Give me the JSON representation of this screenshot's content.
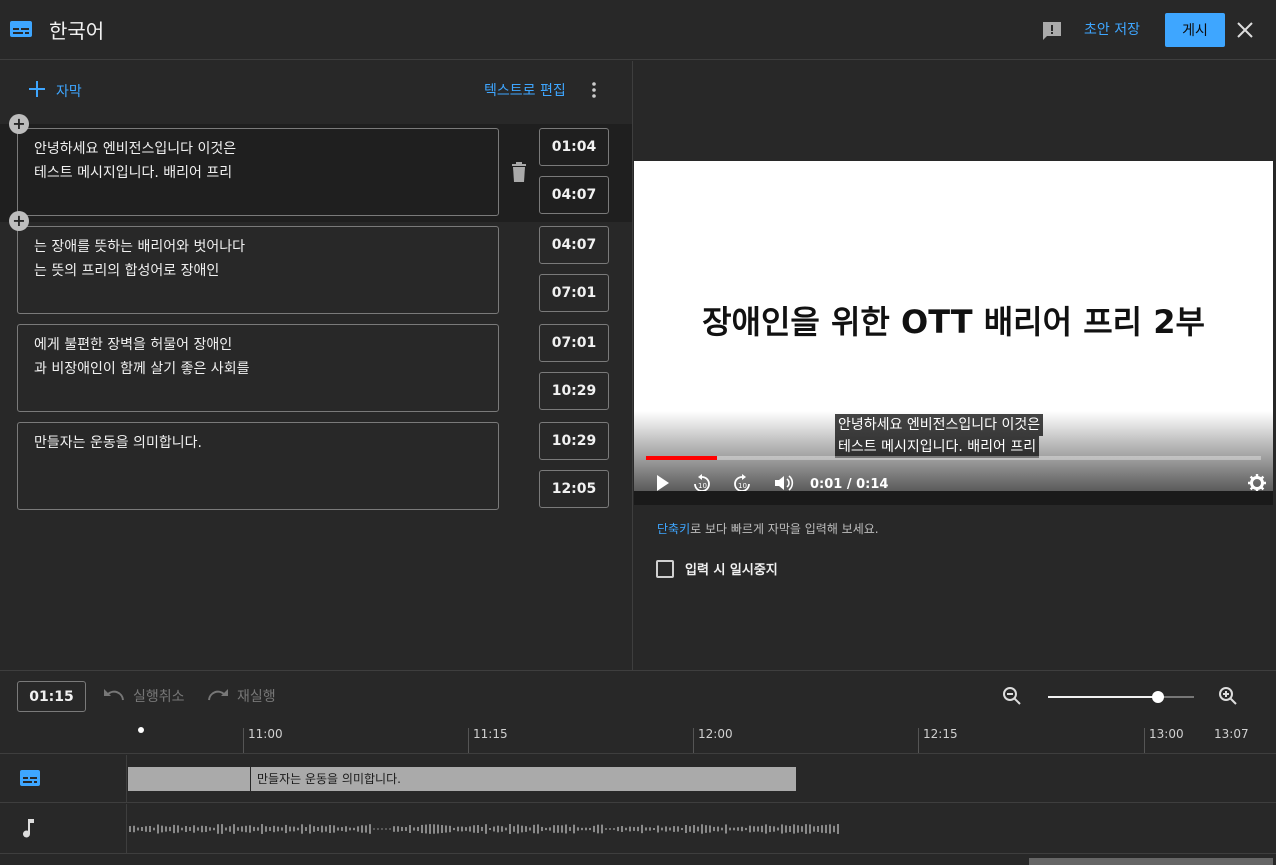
{
  "header": {
    "language": "한국어",
    "save_draft": "초안 저장",
    "publish": "게시"
  },
  "editor": {
    "add_subtitle": "자막",
    "edit_as_text": "텍스트로 편집",
    "cues": [
      {
        "text": "안녕하세요 엔비전스입니다 이것은\n테스트 메시지입니다. 배리어 프리",
        "start": "01:04",
        "end": "04:07"
      },
      {
        "text": "는 장애를 뜻하는 배리어와 벗어나다\n는 뜻의 프리의 합성어로 장애인",
        "start": "04:07",
        "end": "07:01"
      },
      {
        "text": "에게 불편한  장벽을 허물어 장애인\n과 비장애인이 함께 살기 좋은 사회를",
        "start": "07:01",
        "end": "10:29"
      },
      {
        "text": "만들자는 운동을 의미합니다.",
        "start": "10:29",
        "end": "12:05"
      }
    ]
  },
  "video": {
    "slide_title": "장애인을 위한 OTT 배리어 프리 2부",
    "caption_line1": "안녕하세요 엔비전스입니다 이것은",
    "caption_line2": "테스트 메시지입니다. 배리어 프리",
    "time": "0:01 / 0:14",
    "progress": 0.116
  },
  "hint": {
    "link": "단축키",
    "text": "로 보다 빠르게 자막을 입력해 보세요."
  },
  "pause_while_typing": "입력 시 일시중지",
  "toolbar": {
    "current_time": "01:15",
    "undo": "실행취소",
    "redo": "재실행",
    "zoom_level": 0.75
  },
  "timeline": {
    "ticks": [
      "11:00",
      "11:15",
      "12:00",
      "12:15",
      "13:00",
      "13:07"
    ],
    "segment_text": "만들자는 운동을 의미합니다."
  },
  "colors": {
    "accent": "#3ea6ff",
    "background": "#282828",
    "progress": "#ff0000"
  }
}
